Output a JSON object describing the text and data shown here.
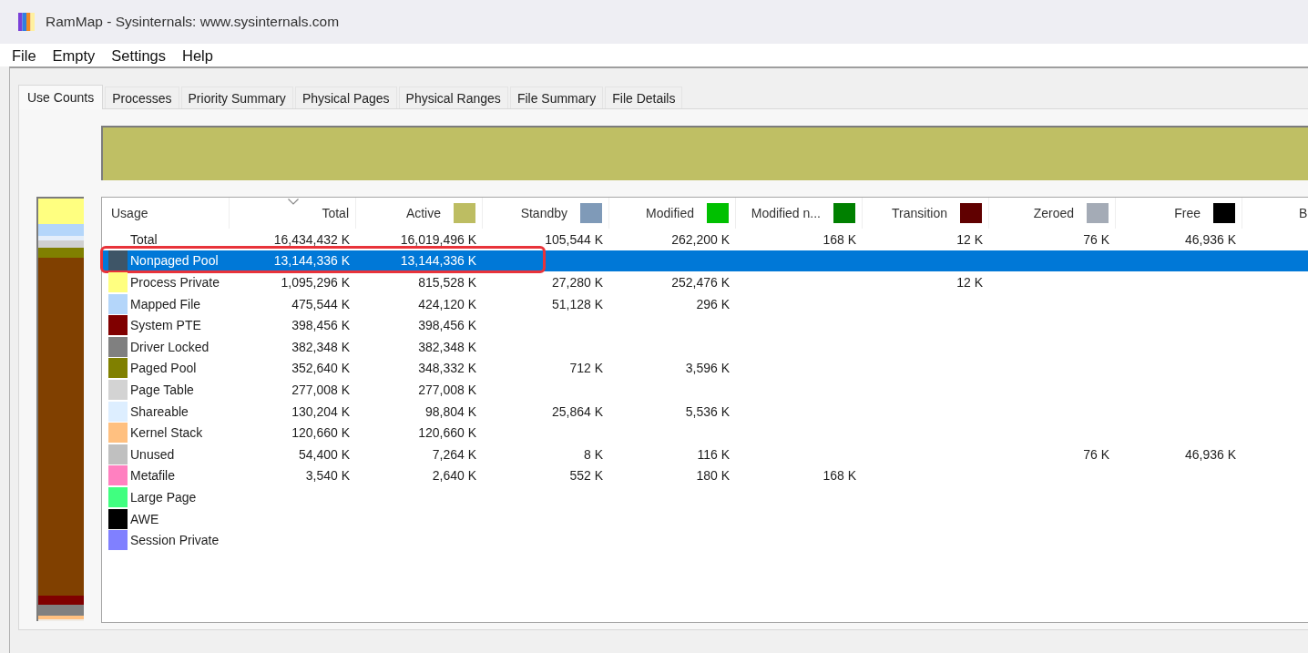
{
  "window": {
    "title": "RamMap - Sysinternals: www.sysinternals.com"
  },
  "menu": [
    "File",
    "Empty",
    "Settings",
    "Help"
  ],
  "tabs": [
    {
      "label": "Use Counts",
      "selected": true
    },
    {
      "label": "Processes",
      "selected": false
    },
    {
      "label": "Priority Summary",
      "selected": false
    },
    {
      "label": "Physical Pages",
      "selected": false
    },
    {
      "label": "Physical Ranges",
      "selected": false
    },
    {
      "label": "File Summary",
      "selected": false
    },
    {
      "label": "File Details",
      "selected": false
    }
  ],
  "table": {
    "columns": [
      {
        "label": "Usage",
        "sorted": false
      },
      {
        "label": "Total",
        "sorted": true
      },
      {
        "label": "Active",
        "color": "#bdbd62",
        "sorted": false
      },
      {
        "label": "Standby",
        "color": "#7f9ab8",
        "sorted": false
      },
      {
        "label": "Modified",
        "color": "#00c000",
        "sorted": false
      },
      {
        "label": "Modified n...",
        "color": "#008000",
        "sorted": false
      },
      {
        "label": "Transition",
        "color": "#600000",
        "sorted": false
      },
      {
        "label": "Zeroed",
        "color": "#a4abb6",
        "sorted": false
      },
      {
        "label": "Free",
        "color": "#000000",
        "sorted": false
      },
      {
        "label": "B",
        "sorted": false
      }
    ],
    "rows": [
      {
        "usage": "Total",
        "total": "16,434,432 K",
        "active": "16,019,496 K",
        "standby": "105,544 K",
        "modified": "262,200 K",
        "modified_n": "168 K",
        "transition": "12 K",
        "zeroed": "76 K",
        "free": "46,936 K",
        "selected": false,
        "outlined": false
      },
      {
        "usage": "Nonpaged Pool",
        "color": "#3e5567",
        "total": "13,144,336 K",
        "active": "13,144,336 K",
        "selected": true,
        "outlined": true
      },
      {
        "usage": "Process Private",
        "color": "#ffff80",
        "total": "1,095,296 K",
        "active": "815,528 K",
        "standby": "27,280 K",
        "modified": "252,476 K",
        "transition": "12 K",
        "selected": false,
        "outlined": false
      },
      {
        "usage": "Mapped File",
        "color": "#b4d6fa",
        "total": "475,544 K",
        "active": "424,120 K",
        "standby": "51,128 K",
        "modified": "296 K",
        "selected": false,
        "outlined": false
      },
      {
        "usage": "System PTE",
        "color": "#800000",
        "total": "398,456 K",
        "active": "398,456 K",
        "selected": false,
        "outlined": false
      },
      {
        "usage": "Driver Locked",
        "color": "#808080",
        "total": "382,348 K",
        "active": "382,348 K",
        "selected": false,
        "outlined": false
      },
      {
        "usage": "Paged Pool",
        "color": "#808000",
        "total": "352,640 K",
        "active": "348,332 K",
        "standby": "712 K",
        "modified": "3,596 K",
        "selected": false,
        "outlined": false
      },
      {
        "usage": "Page Table",
        "color": "#d3d3d3",
        "total": "277,008 K",
        "active": "277,008 K",
        "selected": false,
        "outlined": false
      },
      {
        "usage": "Shareable",
        "color": "#ddeeff",
        "total": "130,204 K",
        "active": "98,804 K",
        "standby": "25,864 K",
        "modified": "5,536 K",
        "selected": false,
        "outlined": false
      },
      {
        "usage": "Kernel Stack",
        "color": "#ffc080",
        "total": "120,660 K",
        "active": "120,660 K",
        "selected": false,
        "outlined": false
      },
      {
        "usage": "Unused",
        "color": "#c0c0c0",
        "total": "54,400 K",
        "active": "7,264 K",
        "standby": "8 K",
        "modified": "116 K",
        "zeroed": "76 K",
        "free": "46,936 K",
        "selected": false,
        "outlined": false
      },
      {
        "usage": "Metafile",
        "color": "#ff80c0",
        "total": "3,540 K",
        "active": "2,640 K",
        "standby": "552 K",
        "modified": "180 K",
        "modified_n": "168 K",
        "selected": false,
        "outlined": false
      },
      {
        "usage": "Large Page",
        "color": "#40ff80",
        "selected": false,
        "outlined": false
      },
      {
        "usage": "AWE",
        "color": "#000000",
        "selected": false,
        "outlined": false
      },
      {
        "usage": "Session Private",
        "color": "#8080ff",
        "selected": false,
        "outlined": false
      }
    ]
  }
}
